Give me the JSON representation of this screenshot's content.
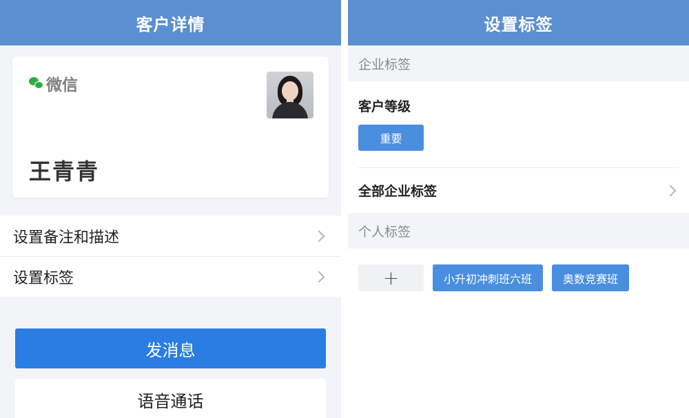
{
  "left_screen": {
    "title": "客户详情",
    "card": {
      "source_label": "微信",
      "customer_name": "王青青"
    },
    "menu": [
      {
        "label": "设置备注和描述"
      },
      {
        "label": "设置标签"
      }
    ],
    "send_message_label": "发消息",
    "voice_call_label": "语音通话"
  },
  "right_screen": {
    "title": "设置标签",
    "corporate_section_label": "企业标签",
    "customer_level_title": "客户等级",
    "customer_level_tag": "重要",
    "all_corporate_tags_label": "全部企业标签",
    "personal_section_label": "个人标签",
    "add_tag_symbol": "+",
    "personal_tags": [
      "小升初冲刺班六班",
      "奥数竞赛班"
    ]
  },
  "colors": {
    "title_bar": "#5a8fd2",
    "primary_button": "#2a7de1",
    "tag_chip": "#4a8ee0",
    "wechat_green": "#2bae44"
  }
}
